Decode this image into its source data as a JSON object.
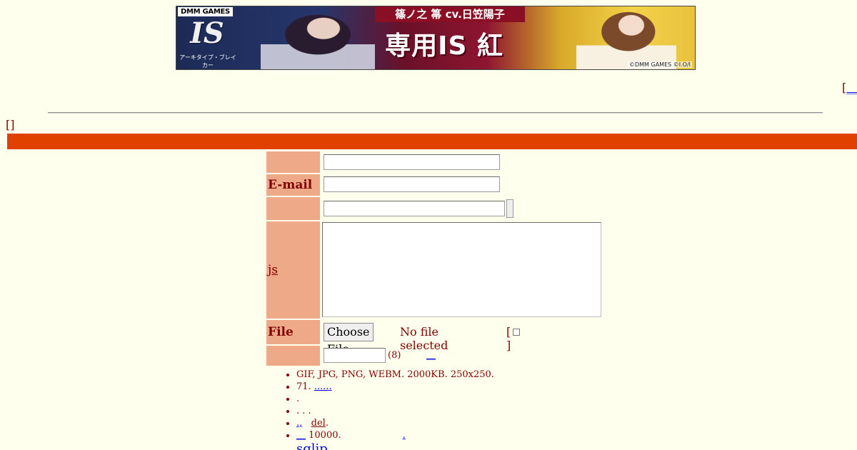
{
  "banner": {
    "brand_badge": "DMM GAMES",
    "logo_text": "IS",
    "logo_subtitle": "アーキタイプ・ブレイカー",
    "character_name": "篠ノ之 箒 cv.日笠陽子",
    "title": "専用IS 紅椿",
    "copyright": "©DMM GAMES ©I.O/I"
  },
  "top_right": {
    "bracket_open": "[",
    "link_text": "__"
  },
  "top_left_bracket": "[]",
  "form": {
    "email_label": "E-mail",
    "comment_label_link": "js",
    "file_label": "File",
    "file_button": "Choose File",
    "file_status": "No file selected",
    "checkbox_bracket_open": "[",
    "checkbox_bracket_close": "]",
    "password_hint": "(8)",
    "password_link": "__"
  },
  "rules": {
    "item1": "GIF, JPG, PNG, WEBM. 2000KB. 250x250.",
    "item2_prefix": "71.",
    "item2_link": "......",
    "item3": ".",
    "item4": ". . .",
    "item5_link": ".,",
    "item5_del": "del",
    "item5_suffix": ".",
    "item6_link": "__",
    "item6_text": "10000.",
    "item6_tail": ".",
    "sglip": "sglip"
  }
}
